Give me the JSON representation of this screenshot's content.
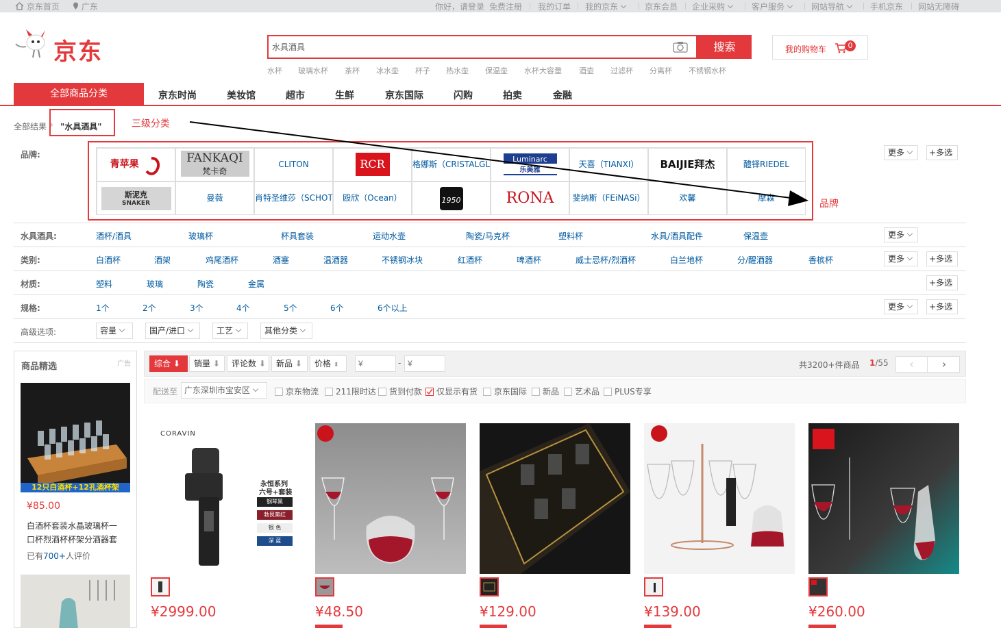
{
  "topbar": {
    "home": "京东首页",
    "location": "广东",
    "greeting": "你好，请登录",
    "register": "免费注册",
    "orders": "我的订单",
    "myjd": "我的京东",
    "member": "京东会员",
    "enterprise": "企业采购",
    "service": "客户服务",
    "sitenav": "网站导航",
    "mobile": "手机京东",
    "access": "网站无障碍"
  },
  "header": {
    "logo": "京东",
    "search_value": "水具酒具",
    "search_button": "搜索",
    "cart_label": "我的购物车",
    "cart_count": "0",
    "hotwords": [
      "水杯",
      "玻璃水杯",
      "茶杯",
      "冰水壶",
      "杯子",
      "热水壶",
      "保温壶",
      "水杯大容量",
      "酒壶",
      "过滤杯",
      "分离杯",
      "不锈钢水杯"
    ]
  },
  "nav": {
    "all": "全部商品分类",
    "items": [
      "京东时尚",
      "美妆馆",
      "超市",
      "生鲜",
      "京东国际",
      "闪购",
      "拍卖",
      "金融"
    ]
  },
  "breadcrumb": {
    "all": "全部结果",
    "query": "\"水具酒具\"",
    "annotation": "三级分类"
  },
  "filter": {
    "brand_label": "品牌:",
    "brand_annotation": "品牌",
    "more": "更多",
    "multi": "多选",
    "brands_row1": [
      "青苹果",
      "FANKAQI",
      "CLITON",
      "RCR",
      "格娜斯（CRISTALGLA",
      "Luminarc",
      "天喜（TIANXI）",
      "BAIJIE拜杰",
      "醴铎RIEDEL"
    ],
    "brands_row1_sub": {
      "fankaqi": "梵卡奇",
      "luminarc": "乐美雅"
    },
    "brands_row2": [
      "斯泥克",
      "曼薇",
      "肖特圣维莎（SCHOTT",
      "殴欣（Ocean）",
      "1950",
      "RONA",
      "斐纳斯（FEiNASi）",
      "欢馨",
      "摩森"
    ],
    "brands_row2_sub": {
      "snaker": "SNAKER"
    },
    "shuiju_label": "水具酒具:",
    "shuiju": [
      "酒杯/酒具",
      "玻璃杯",
      "杯具套装",
      "运动水壶",
      "陶瓷/马克杯",
      "塑料杯",
      "水具/酒具配件",
      "保温壶"
    ],
    "type_label": "类别:",
    "types": [
      "白酒杯",
      "酒架",
      "鸡尾酒杯",
      "酒塞",
      "温酒器",
      "不锈钢冰块",
      "红酒杯",
      "啤酒杯",
      "威士忌杯/烈酒杯",
      "白兰地杯",
      "分/醒酒器",
      "香槟杯"
    ],
    "material_label": "材质:",
    "materials": [
      "塑料",
      "玻璃",
      "陶瓷",
      "金属"
    ],
    "spec_label": "规格:",
    "specs": [
      "1个",
      "2个",
      "3个",
      "4个",
      "5个",
      "6个",
      "6个以上"
    ],
    "adv_label": "高级选项:",
    "adv": [
      "容量",
      "国产/进口",
      "工艺",
      "其他分类"
    ]
  },
  "sidebar": {
    "title": "商品精选",
    "ad": "广告",
    "item_banner": "12只白酒杯+12孔酒杯架",
    "item_price": "¥85.00",
    "item_title": "白酒杯套装水晶玻璃杯一口杯烈酒杯杯架分酒器套",
    "item_reviews_pre": "已有",
    "item_reviews_num": "700+",
    "item_reviews_post": "人评价"
  },
  "sort": {
    "items": [
      "综合",
      "销量",
      "评论数",
      "新品",
      "价格"
    ],
    "price_ph": "¥",
    "total_pre": "共",
    "total_num": "3200+",
    "total_post": "件商品",
    "page_cur": "1",
    "page_total": "/55"
  },
  "filter2": {
    "ship_label": "配送至",
    "ship_value": "广东深圳市宝安区",
    "checks": [
      "京东物流",
      "211限时达",
      "货到付款",
      "仅显示有货",
      "京东国际",
      "新品",
      "艺术品",
      "PLUS专享"
    ]
  },
  "products": [
    {
      "price": "¥2999.00",
      "brand": "CORAVIN",
      "series": "永恒系列",
      "series2": "六号+套装",
      "opts": [
        "钢琴黑",
        "勃艮第红",
        "银 色",
        "深 蓝"
      ]
    },
    {
      "price": "¥48.50"
    },
    {
      "price": "¥129.00"
    },
    {
      "price": "¥139.00"
    },
    {
      "price": "¥260.00"
    }
  ],
  "colors": {
    "accent": "#e4393c",
    "link": "#005aa0"
  }
}
